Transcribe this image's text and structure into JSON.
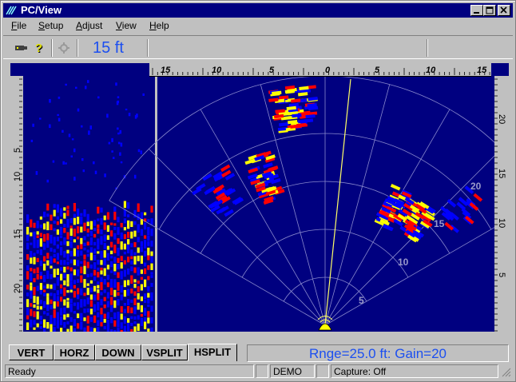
{
  "window": {
    "title": "PC/View"
  },
  "menu": {
    "items": [
      "File",
      "Setup",
      "Adjust",
      "View",
      "Help"
    ]
  },
  "toolbar": {
    "icons": [
      "camera-icon",
      "help-icon",
      "settings-icon"
    ],
    "range_label": "15 ft"
  },
  "rulers": {
    "top_ticks": [
      "15",
      "10",
      "5",
      "0",
      "5",
      "10",
      "15"
    ],
    "left_ticks": [
      "5",
      "10",
      "15",
      "20"
    ],
    "right_ticks": [
      "20",
      "15",
      "10",
      "5"
    ]
  },
  "sonar": {
    "range_rings": [
      "5",
      "10",
      "15",
      "20"
    ],
    "colors": {
      "background": "#000080",
      "blue": "#0000ff",
      "red": "#ff0000",
      "yellow": "#ffff00",
      "grid": "#8888cc"
    }
  },
  "tabs": [
    {
      "label": "VERT",
      "active": false
    },
    {
      "label": "HORZ",
      "active": false
    },
    {
      "label": "DOWN",
      "active": false
    },
    {
      "label": "VSPLIT",
      "active": false
    },
    {
      "label": "HSPLIT",
      "active": true
    }
  ],
  "range_gain": "Rnge=25.0 ft: Gain=20",
  "status": {
    "ready": "Ready",
    "mode": "DEMO",
    "capture": "Capture: Off"
  }
}
